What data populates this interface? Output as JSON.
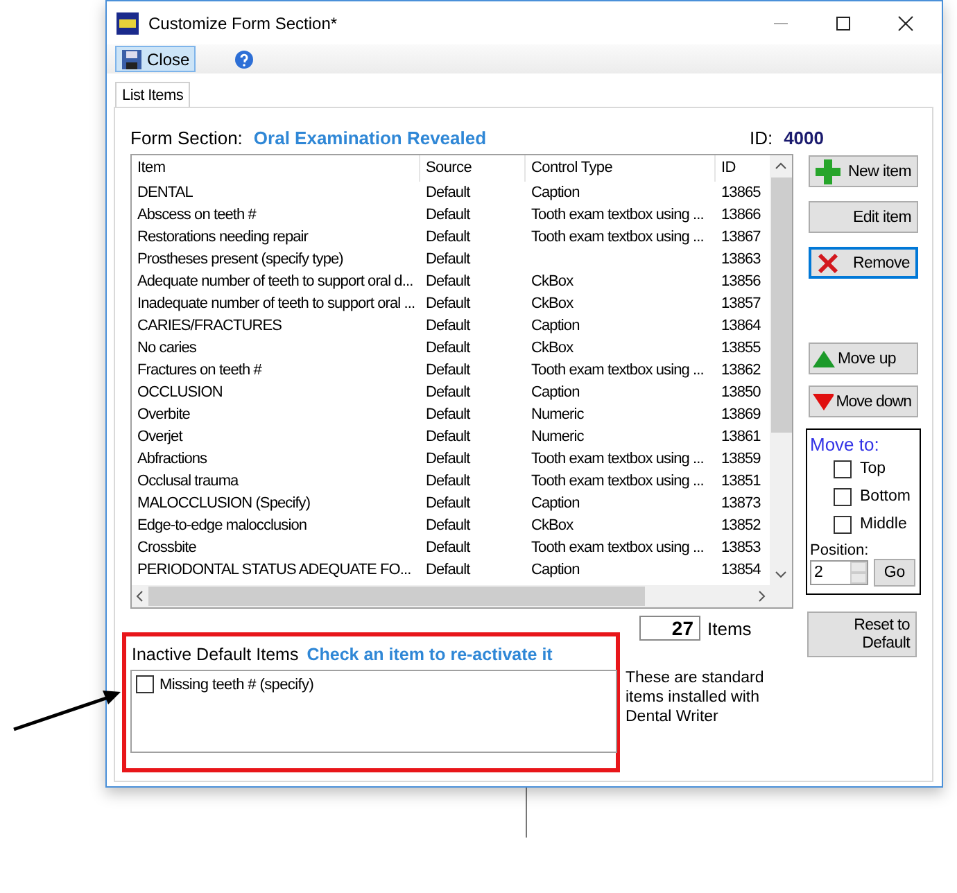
{
  "window": {
    "title": "Customize Form Section*"
  },
  "toolbar": {
    "close_button": "Close"
  },
  "tabs": [
    {
      "label": "List Items",
      "selected": true
    }
  ],
  "form_section": {
    "label": "Form Section:",
    "value": "Oral Examination Revealed",
    "id_label": "ID:",
    "id_value": "4000"
  },
  "list": {
    "columns": [
      "Item",
      "Source",
      "Control Type",
      "ID"
    ],
    "rows": [
      {
        "item": "DENTAL",
        "source": "Default",
        "control_type": "Caption",
        "id": "13865"
      },
      {
        "item": "Abscess on teeth #",
        "source": "Default",
        "control_type": "Tooth exam textbox using ...",
        "id": "13866"
      },
      {
        "item": "Restorations needing repair",
        "source": "Default",
        "control_type": "Tooth exam textbox using ...",
        "id": "13867"
      },
      {
        "item": "Prostheses present (specify type)",
        "source": "Default",
        "control_type": "",
        "id": "13863"
      },
      {
        "item": "Adequate number of teeth to support oral d...",
        "source": "Default",
        "control_type": "CkBox",
        "id": "13856"
      },
      {
        "item": "Inadequate number of teeth to support oral ...",
        "source": "Default",
        "control_type": "CkBox",
        "id": "13857"
      },
      {
        "item": "CARIES/FRACTURES",
        "source": "Default",
        "control_type": "Caption",
        "id": "13864"
      },
      {
        "item": "No caries",
        "source": "Default",
        "control_type": "CkBox",
        "id": "13855"
      },
      {
        "item": "Fractures on teeth #",
        "source": "Default",
        "control_type": "Tooth exam textbox using ...",
        "id": "13862"
      },
      {
        "item": "OCCLUSION",
        "source": "Default",
        "control_type": "Caption",
        "id": "13850"
      },
      {
        "item": "Overbite",
        "source": "Default",
        "control_type": "Numeric",
        "id": "13869"
      },
      {
        "item": "Overjet",
        "source": "Default",
        "control_type": "Numeric",
        "id": "13861"
      },
      {
        "item": "Abfractions",
        "source": "Default",
        "control_type": "Tooth exam textbox using ...",
        "id": "13859"
      },
      {
        "item": "Occlusal trauma",
        "source": "Default",
        "control_type": "Tooth exam textbox using ...",
        "id": "13851"
      },
      {
        "item": "MALOCCLUSION (Specify)",
        "source": "Default",
        "control_type": "Caption",
        "id": "13873"
      },
      {
        "item": "Edge-to-edge malocclusion",
        "source": "Default",
        "control_type": "CkBox",
        "id": "13852"
      },
      {
        "item": "Crossbite",
        "source": "Default",
        "control_type": "Tooth exam textbox using ...",
        "id": "13853"
      },
      {
        "item": "PERIODONTAL STATUS ADEQUATE FO...",
        "source": "Default",
        "control_type": "Caption",
        "id": "13854"
      }
    ]
  },
  "buttons": [
    {
      "kind": "new",
      "label": "New item"
    },
    {
      "kind": "edit",
      "label": "Edit item"
    },
    {
      "kind": "remove",
      "label": "Remove"
    },
    {
      "kind": "up",
      "label": "Move up"
    },
    {
      "kind": "down",
      "label": "Move down"
    }
  ],
  "move_to": {
    "title": "Move to:",
    "options": [
      {
        "label": "Top",
        "checked": false
      },
      {
        "label": "Bottom",
        "checked": false
      },
      {
        "label": "Middle",
        "checked": false
      }
    ],
    "position_label": "Position:",
    "position_value": "2",
    "go_button": "Go"
  },
  "reset_button": "Reset to Default",
  "count": {
    "value": "27",
    "label": "Items"
  },
  "inactive": {
    "label": "Inactive Default Items",
    "hint": "Check an item to re-activate it",
    "items": [
      {
        "label": "Missing teeth # (specify)",
        "checked": false
      }
    ]
  },
  "note": "These are standard items installed with Dental Writer"
}
